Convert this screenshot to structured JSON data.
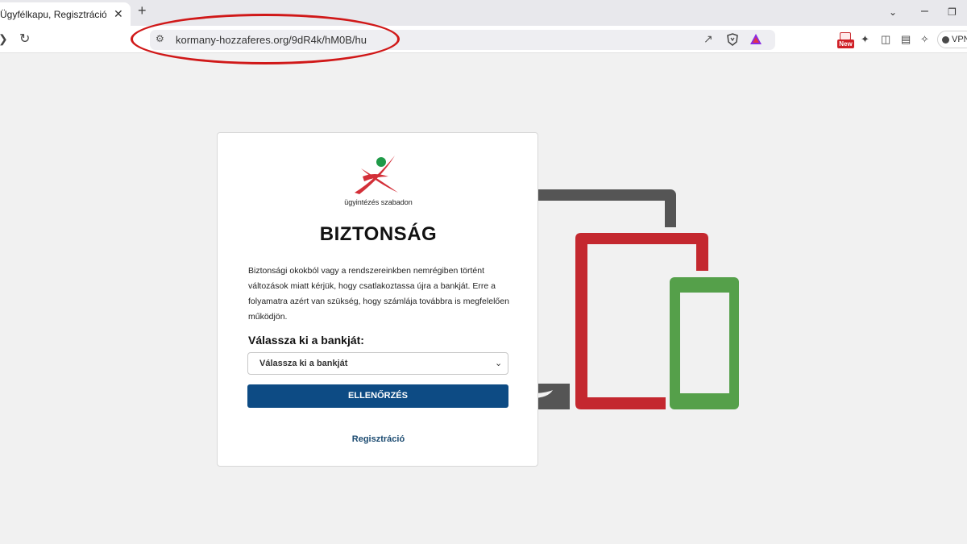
{
  "browser": {
    "tab_title": "Ügyfélkapu, Regisztráció e-szer",
    "tab_close": "✕",
    "new_tab": "+",
    "url": "kormany-hozzaferes.org/9dR4k/hM0B/hu",
    "new_badge": "New",
    "vpn_label": "VPN"
  },
  "page": {
    "logo_caption": "ügyintézés szabadon",
    "heading": "BIZTONSÁG",
    "description": "Biztonsági okokból vagy a rendszereinkben nemrégiben történt változások miatt kérjük, hogy csatlakoztassa újra a bankját. Erre a folyamatra azért van szükség, hogy számlája továbbra is megfelelően működjön.",
    "select_label": "Válassza ki a bankját:",
    "select_value": "Válassza ki a bankját",
    "submit_label": "ELLENŐRZÉS",
    "register_link": "Regisztráció"
  },
  "colors": {
    "button": "#0d4b84",
    "annotation": "#d01818",
    "tablet_red": "#c4282f",
    "phone_green": "#55a04a",
    "laptop_gray": "#555555"
  }
}
